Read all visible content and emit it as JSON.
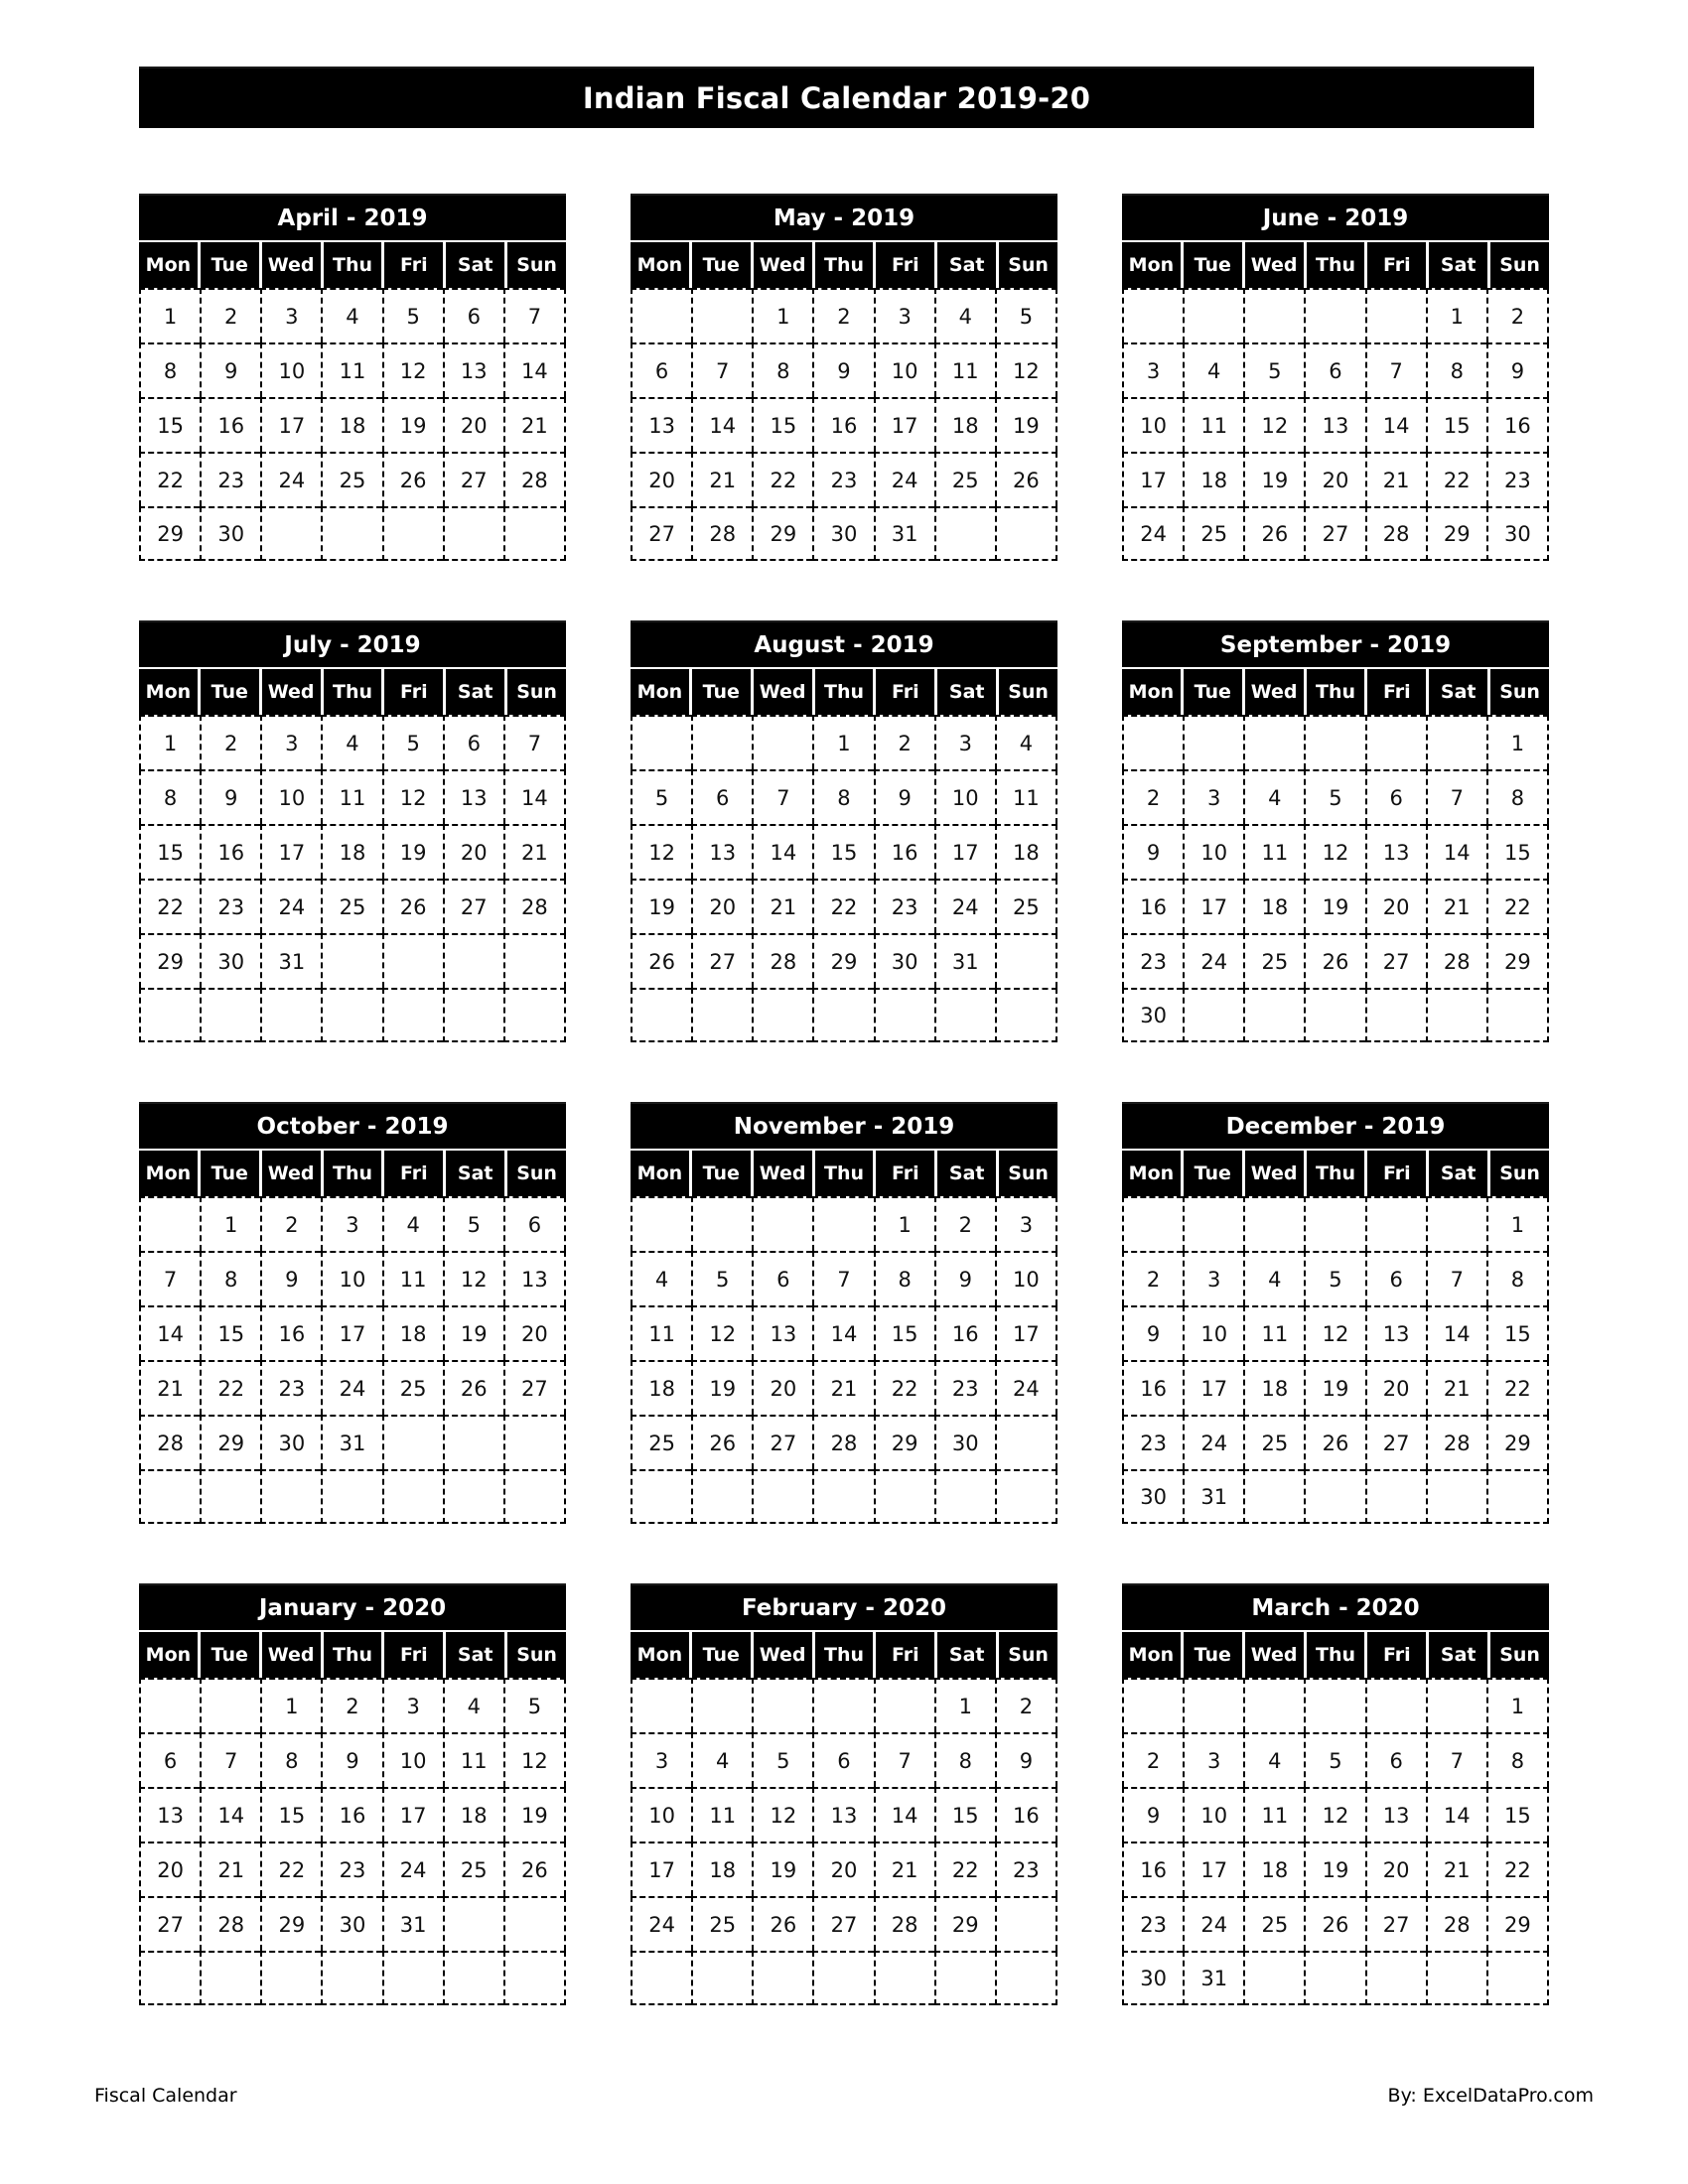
{
  "document": {
    "title": "Indian Fiscal Calendar 2019-20"
  },
  "weekday_headers": [
    "Mon",
    "Tue",
    "Wed",
    "Thu",
    "Fri",
    "Sat",
    "Sun"
  ],
  "footer": {
    "left_label": "Fiscal Calendar",
    "right_label": "By: ExcelDataPro.com"
  },
  "colors": {
    "header_background": "#000000",
    "header_text": "#ffffff",
    "page_background": "#ffffff",
    "grid_line": "#000000",
    "day_text": "#111111"
  },
  "months": [
    {
      "name": "April - 2019",
      "weeks": [
        [
          "1",
          "2",
          "3",
          "4",
          "5",
          "6",
          "7"
        ],
        [
          "8",
          "9",
          "10",
          "11",
          "12",
          "13",
          "14"
        ],
        [
          "15",
          "16",
          "17",
          "18",
          "19",
          "20",
          "21"
        ],
        [
          "22",
          "23",
          "24",
          "25",
          "26",
          "27",
          "28"
        ],
        [
          "29",
          "30",
          "",
          "",
          "",
          "",
          ""
        ]
      ]
    },
    {
      "name": "May - 2019",
      "weeks": [
        [
          "",
          "",
          "1",
          "2",
          "3",
          "4",
          "5"
        ],
        [
          "6",
          "7",
          "8",
          "9",
          "10",
          "11",
          "12"
        ],
        [
          "13",
          "14",
          "15",
          "16",
          "17",
          "18",
          "19"
        ],
        [
          "20",
          "21",
          "22",
          "23",
          "24",
          "25",
          "26"
        ],
        [
          "27",
          "28",
          "29",
          "30",
          "31",
          "",
          ""
        ]
      ]
    },
    {
      "name": "June - 2019",
      "weeks": [
        [
          "",
          "",
          "",
          "",
          "",
          "1",
          "2"
        ],
        [
          "3",
          "4",
          "5",
          "6",
          "7",
          "8",
          "9"
        ],
        [
          "10",
          "11",
          "12",
          "13",
          "14",
          "15",
          "16"
        ],
        [
          "17",
          "18",
          "19",
          "20",
          "21",
          "22",
          "23"
        ],
        [
          "24",
          "25",
          "26",
          "27",
          "28",
          "29",
          "30"
        ]
      ]
    },
    {
      "name": "July - 2019",
      "weeks": [
        [
          "1",
          "2",
          "3",
          "4",
          "5",
          "6",
          "7"
        ],
        [
          "8",
          "9",
          "10",
          "11",
          "12",
          "13",
          "14"
        ],
        [
          "15",
          "16",
          "17",
          "18",
          "19",
          "20",
          "21"
        ],
        [
          "22",
          "23",
          "24",
          "25",
          "26",
          "27",
          "28"
        ],
        [
          "29",
          "30",
          "31",
          "",
          "",
          "",
          ""
        ],
        [
          "",
          "",
          "",
          "",
          "",
          "",
          ""
        ]
      ]
    },
    {
      "name": "August - 2019",
      "weeks": [
        [
          "",
          "",
          "",
          "1",
          "2",
          "3",
          "4"
        ],
        [
          "5",
          "6",
          "7",
          "8",
          "9",
          "10",
          "11"
        ],
        [
          "12",
          "13",
          "14",
          "15",
          "16",
          "17",
          "18"
        ],
        [
          "19",
          "20",
          "21",
          "22",
          "23",
          "24",
          "25"
        ],
        [
          "26",
          "27",
          "28",
          "29",
          "30",
          "31",
          ""
        ],
        [
          "",
          "",
          "",
          "",
          "",
          "",
          ""
        ]
      ]
    },
    {
      "name": "September - 2019",
      "weeks": [
        [
          "",
          "",
          "",
          "",
          "",
          "",
          "1"
        ],
        [
          "2",
          "3",
          "4",
          "5",
          "6",
          "7",
          "8"
        ],
        [
          "9",
          "10",
          "11",
          "12",
          "13",
          "14",
          "15"
        ],
        [
          "16",
          "17",
          "18",
          "19",
          "20",
          "21",
          "22"
        ],
        [
          "23",
          "24",
          "25",
          "26",
          "27",
          "28",
          "29"
        ],
        [
          "30",
          "",
          "",
          "",
          "",
          "",
          ""
        ]
      ]
    },
    {
      "name": "October - 2019",
      "weeks": [
        [
          "",
          "1",
          "2",
          "3",
          "4",
          "5",
          "6"
        ],
        [
          "7",
          "8",
          "9",
          "10",
          "11",
          "12",
          "13"
        ],
        [
          "14",
          "15",
          "16",
          "17",
          "18",
          "19",
          "20"
        ],
        [
          "21",
          "22",
          "23",
          "24",
          "25",
          "26",
          "27"
        ],
        [
          "28",
          "29",
          "30",
          "31",
          "",
          "",
          ""
        ],
        [
          "",
          "",
          "",
          "",
          "",
          "",
          ""
        ]
      ]
    },
    {
      "name": "November - 2019",
      "weeks": [
        [
          "",
          "",
          "",
          "",
          "1",
          "2",
          "3"
        ],
        [
          "4",
          "5",
          "6",
          "7",
          "8",
          "9",
          "10"
        ],
        [
          "11",
          "12",
          "13",
          "14",
          "15",
          "16",
          "17"
        ],
        [
          "18",
          "19",
          "20",
          "21",
          "22",
          "23",
          "24"
        ],
        [
          "25",
          "26",
          "27",
          "28",
          "29",
          "30",
          ""
        ],
        [
          "",
          "",
          "",
          "",
          "",
          "",
          ""
        ]
      ]
    },
    {
      "name": "December - 2019",
      "weeks": [
        [
          "",
          "",
          "",
          "",
          "",
          "",
          "1"
        ],
        [
          "2",
          "3",
          "4",
          "5",
          "6",
          "7",
          "8"
        ],
        [
          "9",
          "10",
          "11",
          "12",
          "13",
          "14",
          "15"
        ],
        [
          "16",
          "17",
          "18",
          "19",
          "20",
          "21",
          "22"
        ],
        [
          "23",
          "24",
          "25",
          "26",
          "27",
          "28",
          "29"
        ],
        [
          "30",
          "31",
          "",
          "",
          "",
          "",
          ""
        ]
      ]
    },
    {
      "name": "January - 2020",
      "weeks": [
        [
          "",
          "",
          "1",
          "2",
          "3",
          "4",
          "5"
        ],
        [
          "6",
          "7",
          "8",
          "9",
          "10",
          "11",
          "12"
        ],
        [
          "13",
          "14",
          "15",
          "16",
          "17",
          "18",
          "19"
        ],
        [
          "20",
          "21",
          "22",
          "23",
          "24",
          "25",
          "26"
        ],
        [
          "27",
          "28",
          "29",
          "30",
          "31",
          "",
          ""
        ],
        [
          "",
          "",
          "",
          "",
          "",
          "",
          ""
        ]
      ]
    },
    {
      "name": "February - 2020",
      "weeks": [
        [
          "",
          "",
          "",
          "",
          "",
          "1",
          "2"
        ],
        [
          "3",
          "4",
          "5",
          "6",
          "7",
          "8",
          "9"
        ],
        [
          "10",
          "11",
          "12",
          "13",
          "14",
          "15",
          "16"
        ],
        [
          "17",
          "18",
          "19",
          "20",
          "21",
          "22",
          "23"
        ],
        [
          "24",
          "25",
          "26",
          "27",
          "28",
          "29",
          ""
        ],
        [
          "",
          "",
          "",
          "",
          "",
          "",
          ""
        ]
      ]
    },
    {
      "name": "March - 2020",
      "weeks": [
        [
          "",
          "",
          "",
          "",
          "",
          "",
          "1"
        ],
        [
          "2",
          "3",
          "4",
          "5",
          "6",
          "7",
          "8"
        ],
        [
          "9",
          "10",
          "11",
          "12",
          "13",
          "14",
          "15"
        ],
        [
          "16",
          "17",
          "18",
          "19",
          "20",
          "21",
          "22"
        ],
        [
          "23",
          "24",
          "25",
          "26",
          "27",
          "28",
          "29"
        ],
        [
          "30",
          "31",
          "",
          "",
          "",
          "",
          ""
        ]
      ]
    }
  ]
}
